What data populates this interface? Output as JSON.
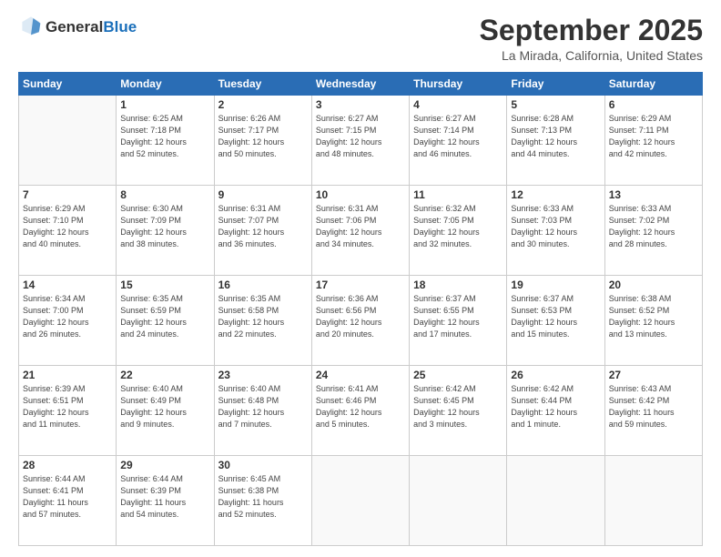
{
  "header": {
    "logo_line1": "General",
    "logo_line2": "Blue",
    "month": "September 2025",
    "location": "La Mirada, California, United States"
  },
  "weekdays": [
    "Sunday",
    "Monday",
    "Tuesday",
    "Wednesday",
    "Thursday",
    "Friday",
    "Saturday"
  ],
  "weeks": [
    [
      {
        "day": "",
        "info": ""
      },
      {
        "day": "1",
        "info": "Sunrise: 6:25 AM\nSunset: 7:18 PM\nDaylight: 12 hours\nand 52 minutes."
      },
      {
        "day": "2",
        "info": "Sunrise: 6:26 AM\nSunset: 7:17 PM\nDaylight: 12 hours\nand 50 minutes."
      },
      {
        "day": "3",
        "info": "Sunrise: 6:27 AM\nSunset: 7:15 PM\nDaylight: 12 hours\nand 48 minutes."
      },
      {
        "day": "4",
        "info": "Sunrise: 6:27 AM\nSunset: 7:14 PM\nDaylight: 12 hours\nand 46 minutes."
      },
      {
        "day": "5",
        "info": "Sunrise: 6:28 AM\nSunset: 7:13 PM\nDaylight: 12 hours\nand 44 minutes."
      },
      {
        "day": "6",
        "info": "Sunrise: 6:29 AM\nSunset: 7:11 PM\nDaylight: 12 hours\nand 42 minutes."
      }
    ],
    [
      {
        "day": "7",
        "info": "Sunrise: 6:29 AM\nSunset: 7:10 PM\nDaylight: 12 hours\nand 40 minutes."
      },
      {
        "day": "8",
        "info": "Sunrise: 6:30 AM\nSunset: 7:09 PM\nDaylight: 12 hours\nand 38 minutes."
      },
      {
        "day": "9",
        "info": "Sunrise: 6:31 AM\nSunset: 7:07 PM\nDaylight: 12 hours\nand 36 minutes."
      },
      {
        "day": "10",
        "info": "Sunrise: 6:31 AM\nSunset: 7:06 PM\nDaylight: 12 hours\nand 34 minutes."
      },
      {
        "day": "11",
        "info": "Sunrise: 6:32 AM\nSunset: 7:05 PM\nDaylight: 12 hours\nand 32 minutes."
      },
      {
        "day": "12",
        "info": "Sunrise: 6:33 AM\nSunset: 7:03 PM\nDaylight: 12 hours\nand 30 minutes."
      },
      {
        "day": "13",
        "info": "Sunrise: 6:33 AM\nSunset: 7:02 PM\nDaylight: 12 hours\nand 28 minutes."
      }
    ],
    [
      {
        "day": "14",
        "info": "Sunrise: 6:34 AM\nSunset: 7:00 PM\nDaylight: 12 hours\nand 26 minutes."
      },
      {
        "day": "15",
        "info": "Sunrise: 6:35 AM\nSunset: 6:59 PM\nDaylight: 12 hours\nand 24 minutes."
      },
      {
        "day": "16",
        "info": "Sunrise: 6:35 AM\nSunset: 6:58 PM\nDaylight: 12 hours\nand 22 minutes."
      },
      {
        "day": "17",
        "info": "Sunrise: 6:36 AM\nSunset: 6:56 PM\nDaylight: 12 hours\nand 20 minutes."
      },
      {
        "day": "18",
        "info": "Sunrise: 6:37 AM\nSunset: 6:55 PM\nDaylight: 12 hours\nand 17 minutes."
      },
      {
        "day": "19",
        "info": "Sunrise: 6:37 AM\nSunset: 6:53 PM\nDaylight: 12 hours\nand 15 minutes."
      },
      {
        "day": "20",
        "info": "Sunrise: 6:38 AM\nSunset: 6:52 PM\nDaylight: 12 hours\nand 13 minutes."
      }
    ],
    [
      {
        "day": "21",
        "info": "Sunrise: 6:39 AM\nSunset: 6:51 PM\nDaylight: 12 hours\nand 11 minutes."
      },
      {
        "day": "22",
        "info": "Sunrise: 6:40 AM\nSunset: 6:49 PM\nDaylight: 12 hours\nand 9 minutes."
      },
      {
        "day": "23",
        "info": "Sunrise: 6:40 AM\nSunset: 6:48 PM\nDaylight: 12 hours\nand 7 minutes."
      },
      {
        "day": "24",
        "info": "Sunrise: 6:41 AM\nSunset: 6:46 PM\nDaylight: 12 hours\nand 5 minutes."
      },
      {
        "day": "25",
        "info": "Sunrise: 6:42 AM\nSunset: 6:45 PM\nDaylight: 12 hours\nand 3 minutes."
      },
      {
        "day": "26",
        "info": "Sunrise: 6:42 AM\nSunset: 6:44 PM\nDaylight: 12 hours\nand 1 minute."
      },
      {
        "day": "27",
        "info": "Sunrise: 6:43 AM\nSunset: 6:42 PM\nDaylight: 11 hours\nand 59 minutes."
      }
    ],
    [
      {
        "day": "28",
        "info": "Sunrise: 6:44 AM\nSunset: 6:41 PM\nDaylight: 11 hours\nand 57 minutes."
      },
      {
        "day": "29",
        "info": "Sunrise: 6:44 AM\nSunset: 6:39 PM\nDaylight: 11 hours\nand 54 minutes."
      },
      {
        "day": "30",
        "info": "Sunrise: 6:45 AM\nSunset: 6:38 PM\nDaylight: 11 hours\nand 52 minutes."
      },
      {
        "day": "",
        "info": ""
      },
      {
        "day": "",
        "info": ""
      },
      {
        "day": "",
        "info": ""
      },
      {
        "day": "",
        "info": ""
      }
    ]
  ]
}
